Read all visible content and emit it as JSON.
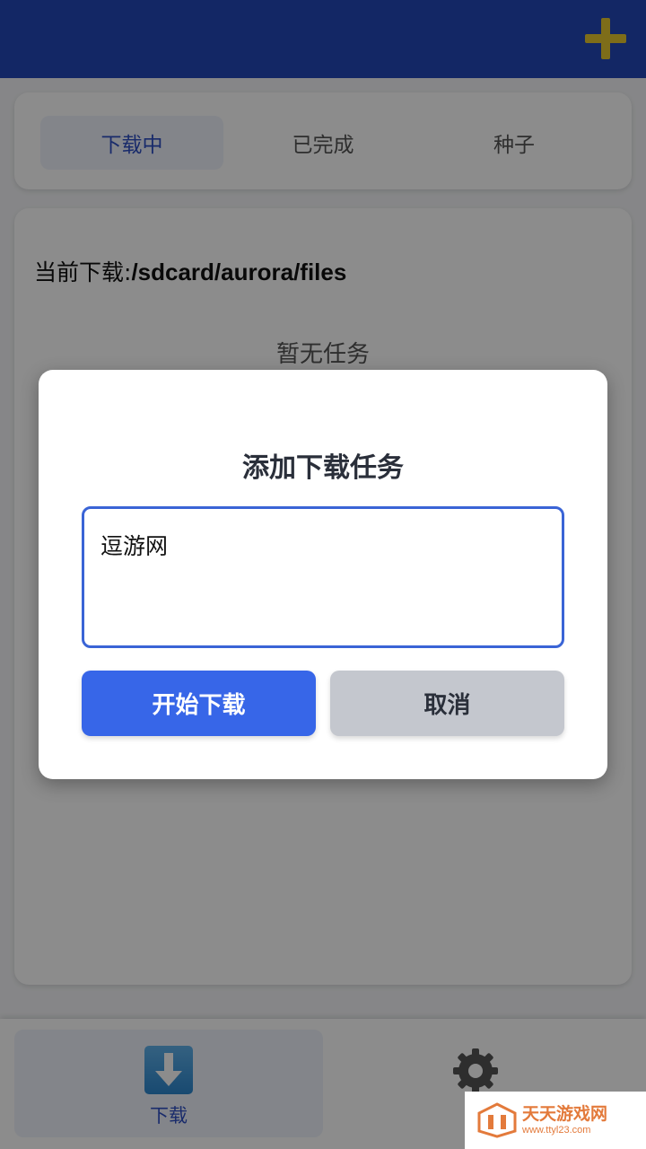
{
  "header": {
    "add_icon": "plus-icon",
    "accent": "#e6c62e",
    "bg": "#2447b8"
  },
  "tabs": [
    {
      "label": "下载中",
      "active": true
    },
    {
      "label": "已完成",
      "active": false
    },
    {
      "label": "种子",
      "active": false
    }
  ],
  "main": {
    "path_label": "当前下载:",
    "path_value": "/sdcard/aurora/files",
    "empty_text": "暂无任务"
  },
  "dialog": {
    "title": "添加下载任务",
    "input_value": "逗游网",
    "start_label": "开始下载",
    "cancel_label": "取消",
    "start_color": "#3766e8",
    "cancel_color": "#c4c7ce"
  },
  "bottom_nav": [
    {
      "label": "下载",
      "icon": "download-icon",
      "active": true
    },
    {
      "label": "设",
      "icon": "gear-icon",
      "active": false
    }
  ],
  "watermark": {
    "cn": "天天游戏网",
    "en": "www.ttyl23.com"
  }
}
